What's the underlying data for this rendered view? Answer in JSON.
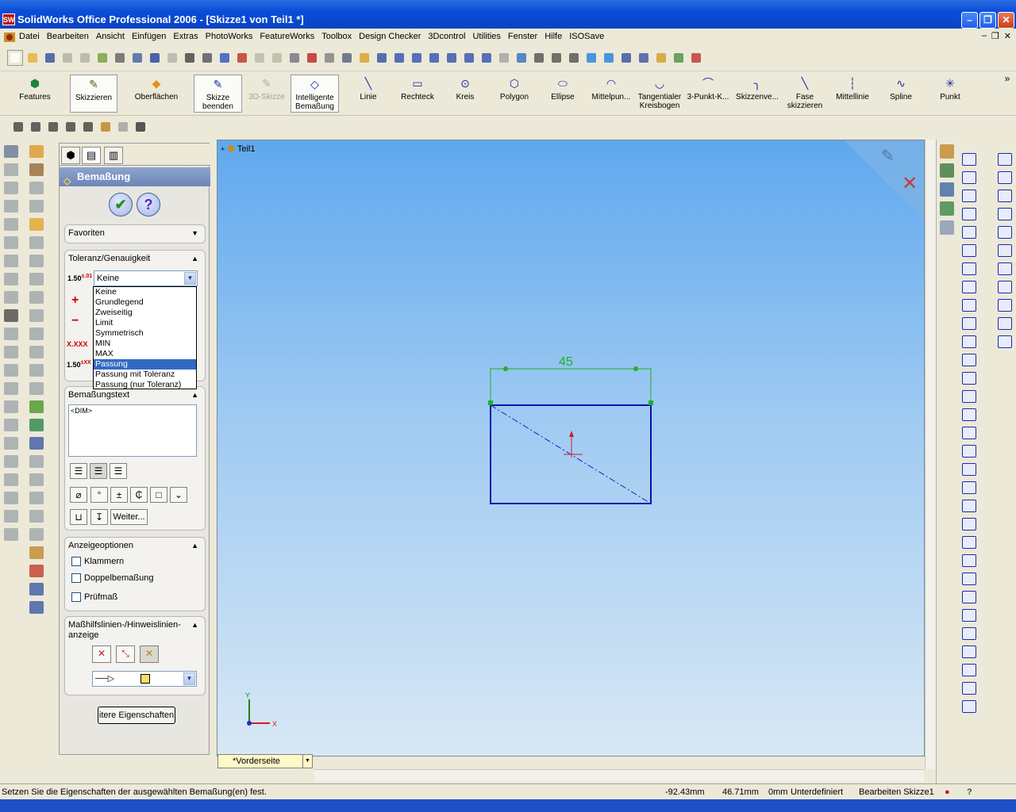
{
  "window": {
    "title": "SolidWorks Office Professional 2006 - [Skizze1 von Teil1 *]",
    "app_icon_text": "SW"
  },
  "menu": {
    "items": [
      "Datei",
      "Bearbeiten",
      "Ansicht",
      "Einfügen",
      "Extras",
      "PhotoWorks",
      "FeatureWorks",
      "Toolbox",
      "Design Checker",
      "3Dcontrol",
      "Utilities",
      "Fenster",
      "Hilfe",
      "ISOSave"
    ]
  },
  "commandmanager": {
    "features": "Features",
    "skizzieren": "Skizzieren",
    "oberflaechen": "Oberflächen",
    "skizze_beenden": "Skizze beenden",
    "skizze_3d": "3D-Skizze",
    "intelligente_bemassung": "Intelligente Bemaßung",
    "linie": "Linie",
    "rechteck": "Rechteck",
    "kreis": "Kreis",
    "polygon": "Polygon",
    "ellipse": "Ellipse",
    "mittelpunkt": "Mittelpun...",
    "tangentialer": "Tangentialer Kreisbogen",
    "dreipunkt": "3-Punkt-K...",
    "skizzenve": "Skizzenve...",
    "fase": "Fase skizzieren",
    "mittellinie": "Mittellinie",
    "spline": "Spline",
    "punkt": "Punkt"
  },
  "pm": {
    "title": "Bemaßung",
    "ok_glyph": "✔",
    "help_glyph": "?",
    "favoriten": "Favoriten",
    "toleranz_title": "Toleranz/Genauigkeit",
    "toleranz_value": "Keine",
    "tolerance_options": [
      "Keine",
      "Grundlegend",
      "Zweiseitig",
      "Limit",
      "Symmetrisch",
      "MIN",
      "MAX",
      "Passung",
      "Passung mit Toleranz",
      "Passung (nur Toleranz)"
    ],
    "tolerance_selected": "Passung",
    "bemassungstext_title": "Bemaßungstext",
    "bemassungstext_value": "<DIM>",
    "weiter": "Weiter...",
    "anzeige_title": "Anzeigeoptionen",
    "klammern": "Klammern",
    "doppelbemassung": "Doppelbemaßung",
    "pruefmass": "Prüfmaß",
    "hilfslinien_title": "Maßhilfslinien-/Hinweislinien-anzeige",
    "weitere_eigenschaften": "itere Eigenschaften"
  },
  "graphics": {
    "tree_root": "Teil1",
    "dimension_value": "45",
    "view_name": "*Vorderseite",
    "axis_x": "X",
    "axis_y": "Y"
  },
  "status": {
    "message": "Setzen Sie die Eigenschaften der ausgewählten Bemaßung(en) fest.",
    "x": "-92.43mm",
    "y": "46.71mm",
    "z": "0mm",
    "state": "Unterdefiniert",
    "editing": "Bearbeiten Skizze1",
    "help": "?"
  }
}
